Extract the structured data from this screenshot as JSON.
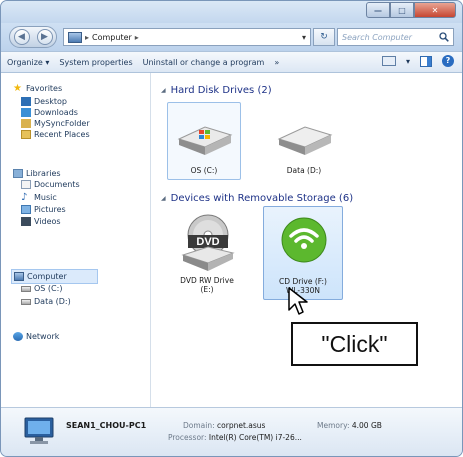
{
  "window": {
    "min_label": "—",
    "max_label": "□",
    "close_label": "✕"
  },
  "address": {
    "back_glyph": "◀",
    "forward_glyph": "▶",
    "segment_sep": "▸",
    "location": "Computer",
    "refresh_glyph": "↻",
    "dropdown_glyph": "▾",
    "search_placeholder": "Search Computer",
    "search_icon": "search-icon"
  },
  "toolbar": {
    "organize": "Organize ▾",
    "system_properties": "System properties",
    "uninstall": "Uninstall or change a program",
    "more": "»",
    "help": "?"
  },
  "nav": {
    "favorites": "Favorites",
    "desktop": "Desktop",
    "downloads": "Downloads",
    "mysync": "MySyncFolder",
    "recent": "Recent Places",
    "libraries": "Libraries",
    "documents": "Documents",
    "music": "Music",
    "pictures": "Pictures",
    "videos": "Videos",
    "computer": "Computer",
    "os_c": "OS (C:)",
    "data_d": "Data (D:)",
    "network": "Network"
  },
  "main": {
    "hdd_group": "Hard Disk Drives (2)",
    "removable_group": "Devices with Removable Storage (6)",
    "drive_os": "OS (C:)",
    "drive_data": "Data (D:)",
    "dvd_line1": "DVD RW Drive",
    "dvd_line2": "(E:)",
    "dvd_badge": "DVD",
    "cd_line1": "CD Drive (F:)",
    "cd_line2": "WL-330N"
  },
  "details": {
    "pc_name": "SEAN1_CHOU-PC1",
    "domain_label": "Domain:",
    "domain_value": "corpnet.asus",
    "memory_label": "Memory:",
    "memory_value": "4.00 GB",
    "processor_label": "Processor:",
    "processor_value": "Intel(R) Core(TM) i7-26..."
  },
  "callout": {
    "text": "\"Click\""
  },
  "colors": {
    "frame": "#b9d1ea",
    "group_header": "#1e3287",
    "selection": "#cde4fb",
    "wifi_green": "#5cb82e"
  }
}
